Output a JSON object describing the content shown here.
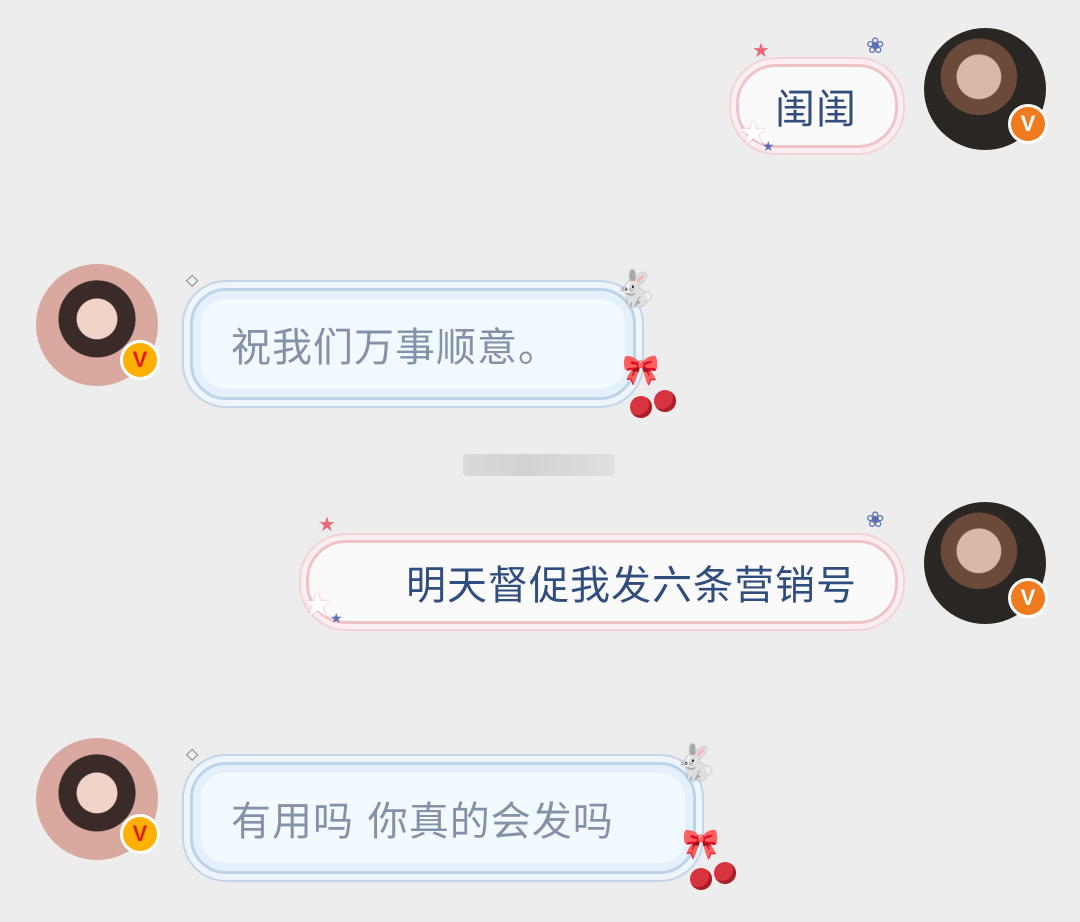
{
  "messages": [
    {
      "side": "right",
      "text": "闺闺"
    },
    {
      "side": "left",
      "text": "祝我们万事顺意。"
    },
    {
      "side": "right",
      "text": "明天督促我发六条营销号"
    },
    {
      "side": "left",
      "text": "有用吗 你真的会发吗"
    }
  ],
  "badges": {
    "verified": "V"
  },
  "colors": {
    "background": "#ededed",
    "right_text": "#2f4d7d",
    "left_text": "#8392a6",
    "badge_orange": "#f07a1e",
    "badge_gold": "#ffb000"
  }
}
